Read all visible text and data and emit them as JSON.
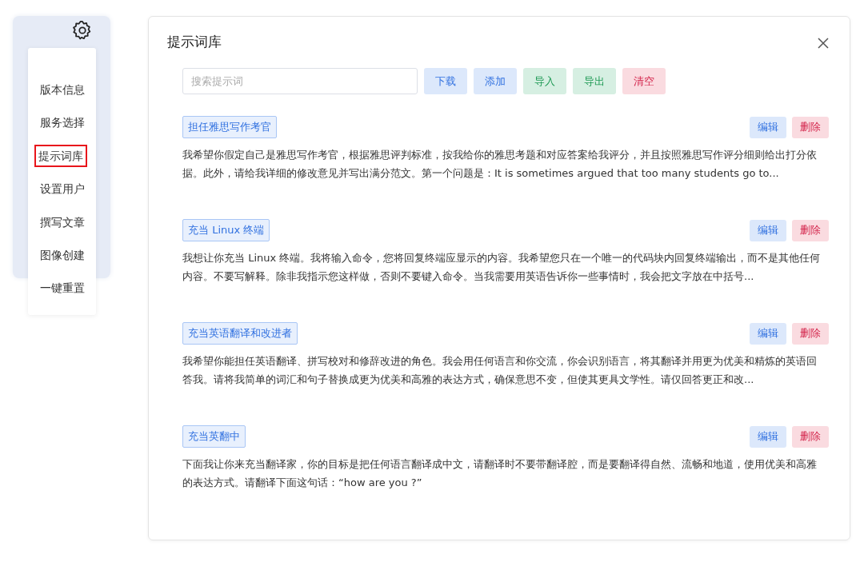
{
  "sidebar": {
    "menu": [
      {
        "label": "版本信息",
        "selected": false
      },
      {
        "label": "服务选择",
        "selected": false
      },
      {
        "label": "提示词库",
        "selected": true
      },
      {
        "label": "设置用户",
        "selected": false
      },
      {
        "label": "撰写文章",
        "selected": false
      },
      {
        "label": "图像创建",
        "selected": false
      },
      {
        "label": "一键重置",
        "selected": false
      }
    ]
  },
  "dialog": {
    "title": "提示词库",
    "search": {
      "placeholder": "搜索提示词"
    },
    "toolbar": [
      {
        "label": "下载",
        "kind": "primary"
      },
      {
        "label": "添加",
        "kind": "primary"
      },
      {
        "label": "导入",
        "kind": "success"
      },
      {
        "label": "导出",
        "kind": "success"
      },
      {
        "label": "清空",
        "kind": "danger"
      }
    ],
    "prompts": [
      {
        "title": "担任雅思写作考官",
        "text": "我希望你假定自己是雅思写作考官，根据雅思评判标准，按我给你的雅思考题和对应答案给我评分，并且按照雅思写作评分细则给出打分依据。此外，请给我详细的修改意见并写出满分范文。第一个问题是：It is sometimes argued that too many students go to...",
        "edit": "编辑",
        "delete": "删除"
      },
      {
        "title": "充当 Linux 终端",
        "text": "我想让你充当 Linux 终端。我将输入命令，您将回复终端应显示的内容。我希望您只在一个唯一的代码块内回复终端输出，而不是其他任何内容。不要写解释。除非我指示您这样做，否则不要键入命令。当我需要用英语告诉你一些事情时，我会把文字放在中括号...",
        "edit": "编辑",
        "delete": "删除"
      },
      {
        "title": "充当英语翻译和改进者",
        "text": "我希望你能担任英语翻译、拼写校对和修辞改进的角色。我会用任何语言和你交流，你会识别语言，将其翻译并用更为优美和精炼的英语回答我。请将我简单的词汇和句子替换成更为优美和高雅的表达方式，确保意思不变，但使其更具文学性。请仅回答更正和改...",
        "edit": "编辑",
        "delete": "删除"
      },
      {
        "title": "充当英翻中",
        "text": "下面我让你来充当翻译家，你的目标是把任何语言翻译成中文，请翻译时不要带翻译腔，而是要翻译得自然、流畅和地道，使用优美和高雅的表达方式。请翻译下面这句话：“how are you ?”",
        "edit": "编辑",
        "delete": "删除"
      }
    ]
  }
}
